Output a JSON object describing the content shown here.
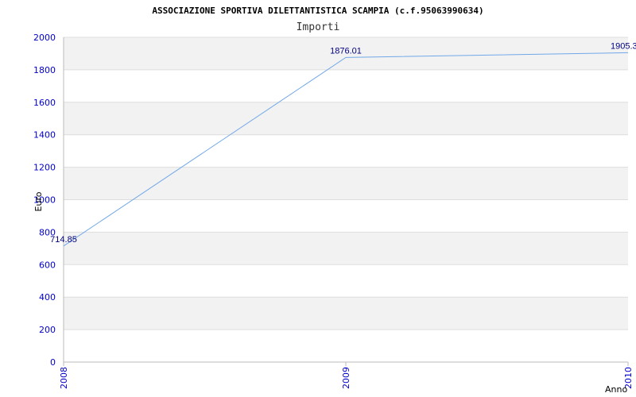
{
  "chart_data": {
    "type": "line",
    "title": "ASSOCIAZIONE SPORTIVA DILETTANTISTICA SCAMPIA (c.f.95063990634)",
    "subtitle": "Importi",
    "xlabel": "Anno",
    "ylabel": "Euro",
    "categories": [
      "2008",
      "2009",
      "2010"
    ],
    "series": [
      {
        "values": [
          714.85,
          1876.01,
          1905.3
        ],
        "labels": [
          "714.85",
          "1876.01",
          "1905.3"
        ]
      }
    ],
    "ylim": [
      0,
      2000
    ],
    "yticks": [
      "0",
      "200",
      "400",
      "600",
      "800",
      "1000",
      "1200",
      "1400",
      "1600",
      "1800",
      "2000"
    ],
    "grid": true,
    "colors": {
      "line": "#70a8e8",
      "band": "#f2f2f2",
      "grid": "#dddddd",
      "tick": "#0000cc",
      "data_label": "#000080"
    }
  }
}
